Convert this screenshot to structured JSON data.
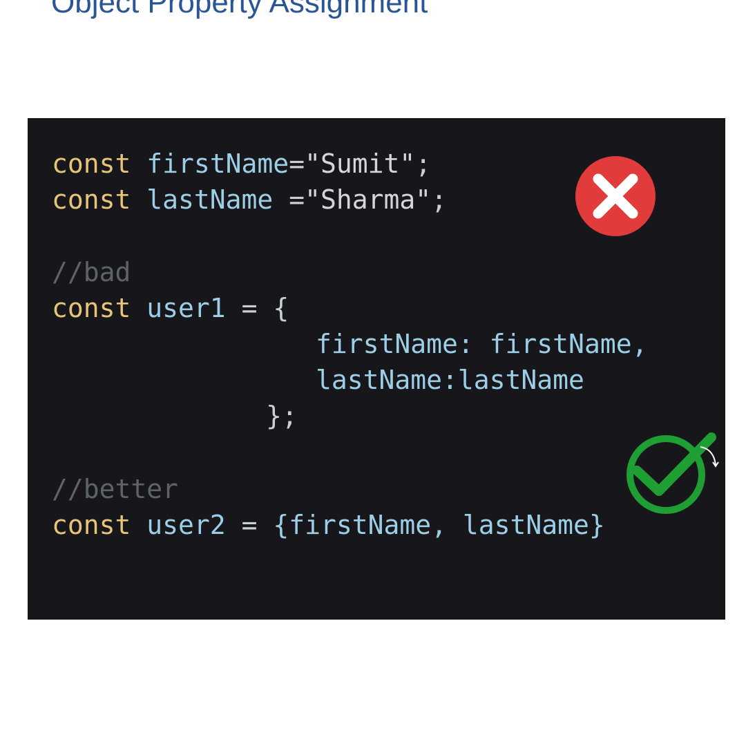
{
  "title": "Object Property Assignment",
  "code": {
    "line1": {
      "kw": "const",
      "id": "firstName",
      "op": "=",
      "str": "\"Sumit\"",
      "end": ";"
    },
    "line2": {
      "kw": "const",
      "id": "lastName",
      "op": "=",
      "str": "\"Sharma\"",
      "end": ";"
    },
    "comment_bad": "//bad",
    "line3": {
      "kw": "const",
      "id": "user1",
      "op": "=",
      "brace": "{"
    },
    "line4": {
      "key": "firstName:",
      "value": "firstName,"
    },
    "line5": {
      "key": "lastName:",
      "value": "lastName"
    },
    "line6": {
      "close": "};"
    },
    "comment_better": "//better",
    "line7": {
      "kw": "const",
      "id": "user2",
      "op": "=",
      "obj": "{firstName, lastName}"
    }
  },
  "badges": {
    "bad": {
      "icon": "x-icon",
      "color": "#e23b3b"
    },
    "good": {
      "icon": "checkmark-icon",
      "color": "#1f9e34"
    }
  }
}
